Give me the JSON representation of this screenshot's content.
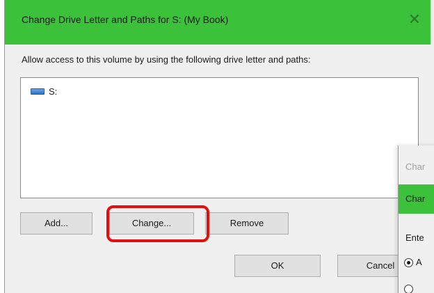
{
  "main_dialog": {
    "title": "Change Drive Letter and Paths for S: (My Book)",
    "close_glyph": "✕",
    "description": "Allow access to this volume by using the following drive letter and paths:",
    "list": {
      "items": [
        {
          "label": "S:",
          "icon": "drive-icon"
        }
      ]
    },
    "buttons": {
      "add": "Add...",
      "change": "Change...",
      "remove": "Remove",
      "ok": "OK",
      "cancel": "Cancel"
    },
    "highlight_color": "#e01010",
    "titlebar_color": "#3cc13a"
  },
  "background_dialog": {
    "title_fragment": "Char",
    "bar_fragment": "Char",
    "label_fragment": "Ente",
    "radio_fragment": "A"
  }
}
